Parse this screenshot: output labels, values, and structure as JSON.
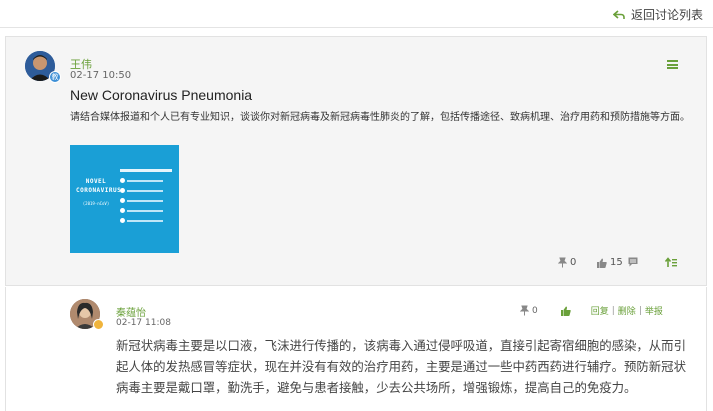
{
  "topbar": {
    "back_label": "返回讨论列表"
  },
  "post": {
    "author": "王伟",
    "time": "02-17 10:50",
    "badge": "教",
    "title": "New Coronavirus Pneumonia",
    "description": "请结合媒体报道和个人已有专业知识，谈谈你对新冠病毒及新冠病毒性肺炎的了解，包括传播途径、致病机理、治疗用药和预防措施等方面。",
    "thumbnail": {
      "title": "NOVEL CORONAVIRUS",
      "subtitle": "(2019-nCoV)"
    },
    "actions": {
      "pin_count": "0",
      "like_count": "15"
    }
  },
  "reply": {
    "author": "秦蕴怡",
    "time": "02-17 11:08",
    "pin_count": "0",
    "reply_label": "回复",
    "delete_label": "删除",
    "report_label": "举报",
    "separator": "|",
    "text": "新冠状病毒主要是以口液，飞沫进行传播的，该病毒入通过侵呼吸道，直接引起寄宿细胞的感染，从而引起人体的发热感冒等症状，现在并没有有效的治疗用药，主要是通过一些中药西药进行辅疗。预防新冠状病毒主要是戴口罩，勤洗手，避免与患者接触，少去公共场所，增强锻炼，提高自己的免疫力。"
  },
  "colors": {
    "accent": "#6aa03a",
    "thumbnail_bg": "#1a9fd6"
  }
}
